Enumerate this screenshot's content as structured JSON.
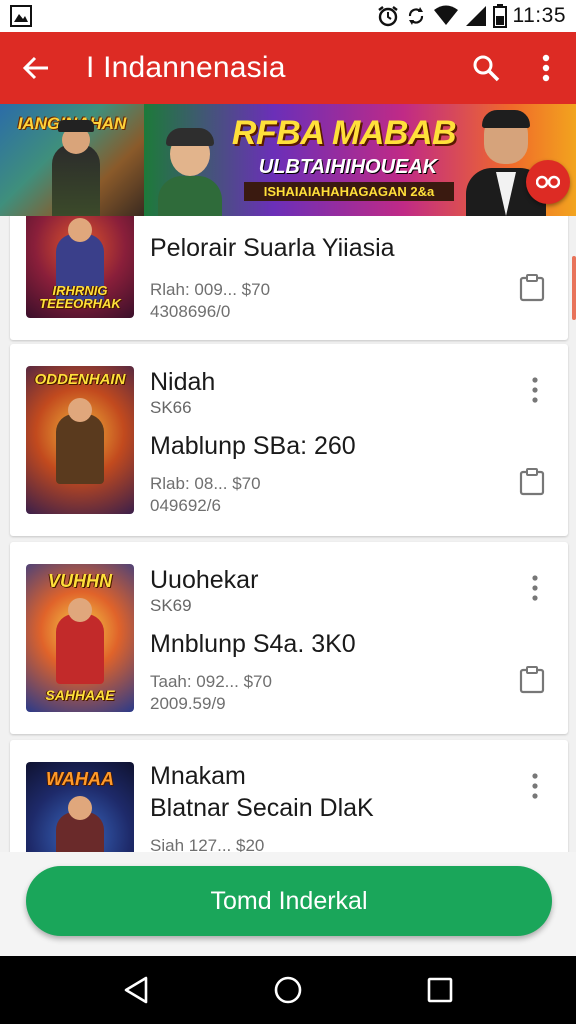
{
  "status_bar": {
    "time": "11:35",
    "icons": [
      "gallery-icon",
      "alarm-icon",
      "sync-icon",
      "wifi-icon",
      "signal-icon",
      "battery-icon"
    ]
  },
  "app_bar": {
    "title": "I Indannenasia",
    "icons": [
      "back-arrow-icon",
      "search-icon",
      "more-vert-icon"
    ],
    "color": "#dd2b24"
  },
  "banner": {
    "left_title": "IANGINAHAN",
    "title": "RFBA MABAB",
    "subtitle": "ULBTAIHIHOUEAK",
    "tag": "ISHAIAIAHAHAGAGAN 2&a",
    "fab_icon": "link-icon"
  },
  "items": [
    {
      "thumb_title": "IRHRNIG TEEEORHAK",
      "title": "Pelorair Suarla Yiiasia",
      "price": "Rlah: 009... $70",
      "id": "4308696/0"
    },
    {
      "thumb_title": "ODDENHAIN",
      "title": "Nidah",
      "sku": "SK66",
      "subtitle": "Mablunp SBa: 260",
      "price": "Rlab: 08... $70",
      "id": "049692/6"
    },
    {
      "thumb_title": "VUHHN",
      "thumb_bottom": "SAHHAAE",
      "title": "Uuohekar",
      "sku": "SK69",
      "subtitle": "Mnblunp S4a. 3K0",
      "price": "Taah: 092... $70",
      "id": "2009.59/9"
    },
    {
      "thumb_title": "WAHAA",
      "title": "Mnakam",
      "subtitle": "Blatnar Secain DlaK",
      "price": "Siah 127... $20"
    }
  ],
  "cta": {
    "label": "Tomd Inderkal",
    "color": "#1aa65a"
  },
  "nav": {
    "icons": [
      "back-triangle-icon",
      "home-circle-icon",
      "recents-square-icon"
    ]
  }
}
